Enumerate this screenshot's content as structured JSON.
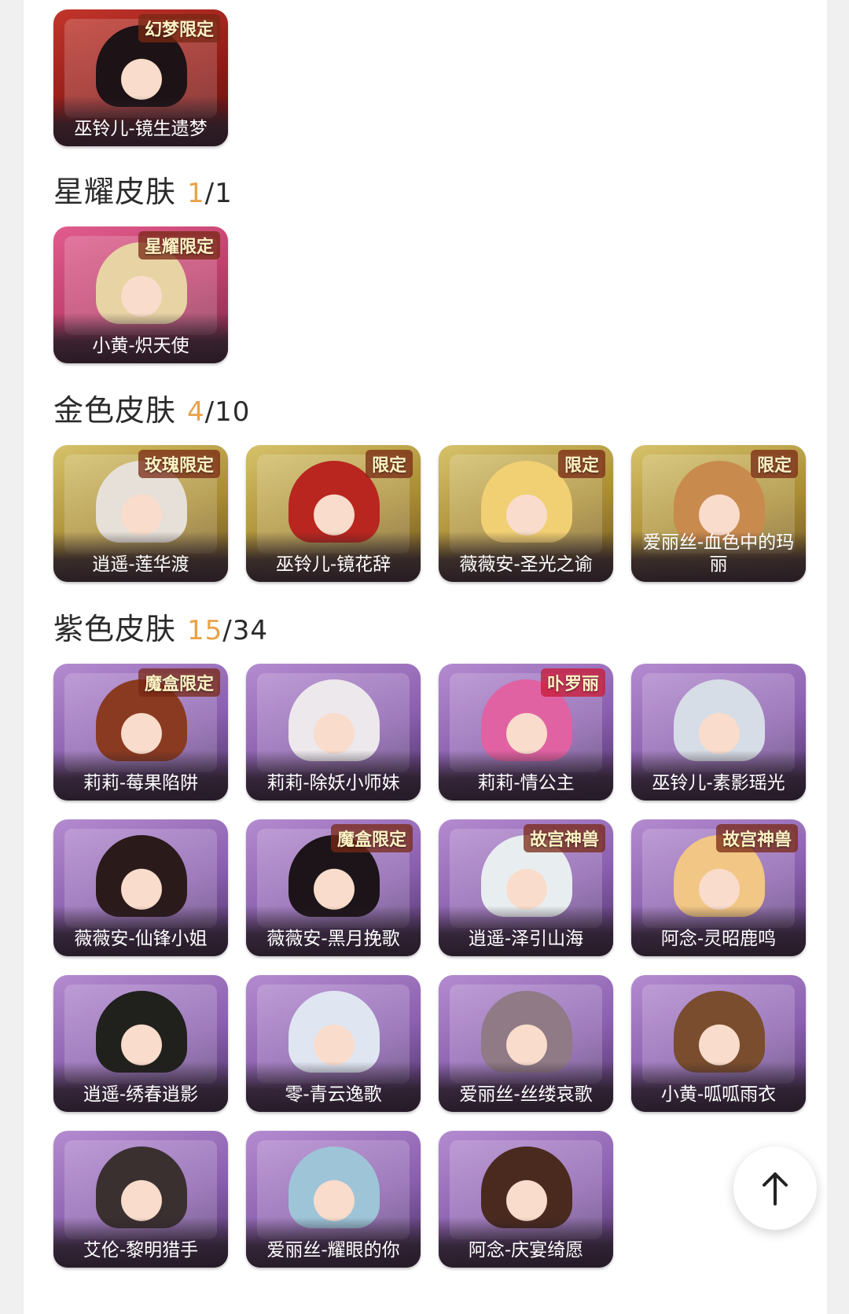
{
  "top_skin": {
    "name": "巫铃儿-镜生遗梦",
    "badge": "幻梦限定",
    "icon": "character-portrait"
  },
  "sections": [
    {
      "title": "星耀皮肤",
      "owned": "1",
      "total": "/1",
      "skins": [
        {
          "name": "小黄-炽天使",
          "badge": "星耀限定",
          "icon": "character-portrait"
        }
      ]
    },
    {
      "title": "金色皮肤",
      "owned": "4",
      "total": "/10",
      "skins": [
        {
          "name": "逍遥-莲华渡",
          "badge": "玫瑰限定",
          "icon": "character-portrait"
        },
        {
          "name": "巫铃儿-镜花辞",
          "badge": "限定",
          "icon": "character-portrait"
        },
        {
          "name": "薇薇安-圣光之谕",
          "badge": "限定",
          "icon": "character-portrait"
        },
        {
          "name": "爱丽丝-血色中的玛丽",
          "badge": "限定",
          "icon": "character-portrait"
        }
      ]
    },
    {
      "title": "紫色皮肤",
      "owned": "15",
      "total": "/34",
      "skins": [
        {
          "name": "莉莉-莓果陷阱",
          "badge": "魔盒限定",
          "icon": "character-portrait"
        },
        {
          "name": "莉莉-除妖小师妹",
          "badge": "",
          "icon": "character-portrait"
        },
        {
          "name": "莉莉-情公主",
          "badge": "卟罗丽",
          "icon": "character-portrait"
        },
        {
          "name": "巫铃儿-素影瑶光",
          "badge": "",
          "icon": "character-portrait"
        },
        {
          "name": "薇薇安-仙锋小姐",
          "badge": "",
          "icon": "character-portrait"
        },
        {
          "name": "薇薇安-黑月挽歌",
          "badge": "魔盒限定",
          "icon": "character-portrait"
        },
        {
          "name": "逍遥-泽引山海",
          "badge": "故宫神兽",
          "icon": "character-portrait"
        },
        {
          "name": "阿念-灵昭鹿鸣",
          "badge": "故宫神兽",
          "icon": "character-portrait"
        },
        {
          "name": "逍遥-绣春逍影",
          "badge": "",
          "icon": "character-portrait"
        },
        {
          "name": "零-青云逸歌",
          "badge": "",
          "icon": "character-portrait"
        },
        {
          "name": "爱丽丝-丝缕哀歌",
          "badge": "",
          "icon": "character-portrait"
        },
        {
          "name": "小黄-呱呱雨衣",
          "badge": "",
          "icon": "character-portrait"
        },
        {
          "name": "艾伦-黎明猎手",
          "badge": "",
          "icon": "character-portrait"
        },
        {
          "name": "爱丽丝-耀眼的你",
          "badge": "",
          "icon": "character-portrait"
        },
        {
          "name": "阿念-庆宴绮愿",
          "badge": "",
          "icon": "character-portrait"
        }
      ]
    }
  ],
  "scroll_top": {
    "icon": "arrow-up-icon"
  },
  "colors": {
    "accent": "#e8a24a",
    "gold": "#c9ae4e",
    "purple": "#8a5fae",
    "star": "#d2507f",
    "red": "#b42c24"
  }
}
